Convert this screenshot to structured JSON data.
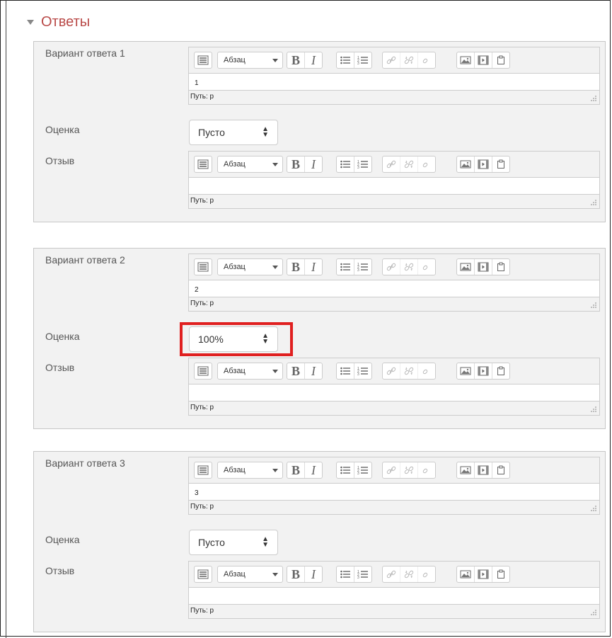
{
  "section": {
    "title": "Ответы"
  },
  "toolbar": {
    "format_label": "Абзац"
  },
  "labels": {
    "grade": "Оценка",
    "feedback": "Отзыв",
    "path": "Путь: p"
  },
  "answers": [
    {
      "label": "Вариант ответа 1",
      "text": "1",
      "grade": "Пусто"
    },
    {
      "label": "Вариант ответа 2",
      "text": "2",
      "grade": "100%"
    },
    {
      "label": "Вариант ответа 3",
      "text": "3",
      "grade": "Пусто"
    }
  ],
  "colors": {
    "section_title": "#b94a48",
    "highlight": "#e02020"
  }
}
